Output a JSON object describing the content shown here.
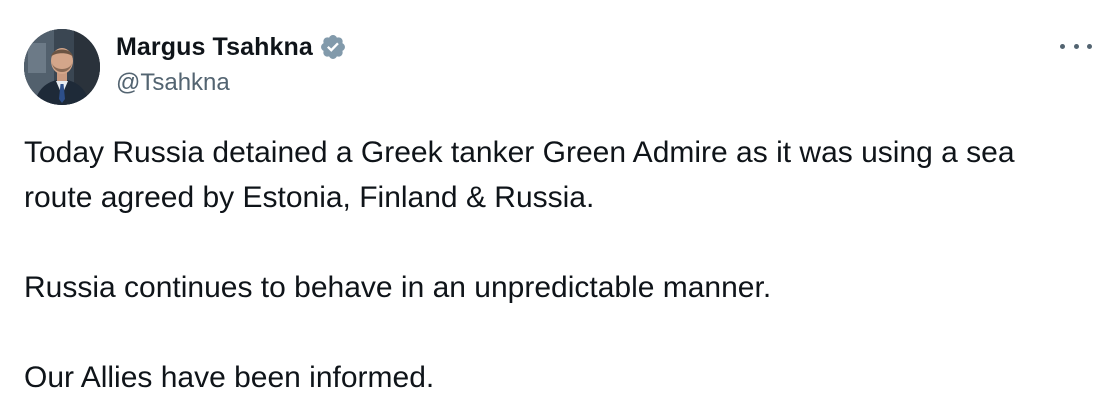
{
  "author": {
    "display_name": "Margus Tsahkna",
    "handle": "@Tsahkna",
    "verified_icon": "verified-badge-icon",
    "verified_color": "#829aab"
  },
  "menu": {
    "icon": "more-options-icon"
  },
  "tweet": {
    "line1": "Today Russia detained a Greek tanker Green Admire as it was using a sea",
    "line2": "route agreed by Estonia, Finland & Russia.",
    "line3": "Russia continues to behave in an unpredictable manner.",
    "line4": "Our Allies have been informed."
  }
}
